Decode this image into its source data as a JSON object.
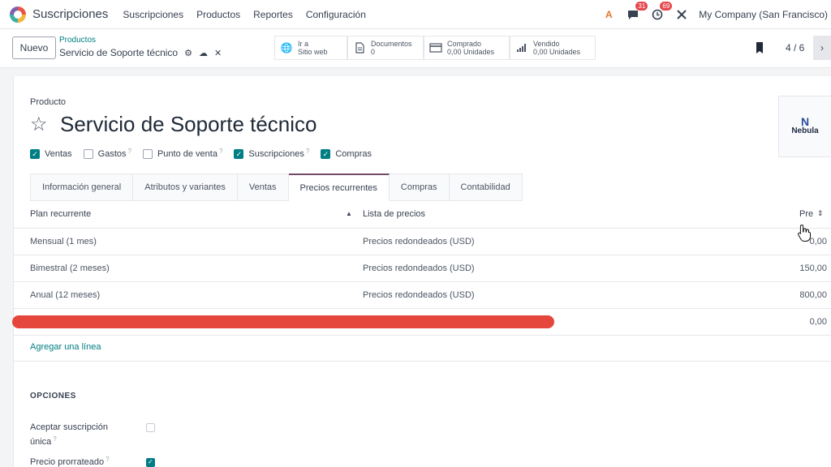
{
  "nav": {
    "app_title": "Suscripciones",
    "menu": [
      "Suscripciones",
      "Productos",
      "Reportes",
      "Configuración"
    ],
    "messages_badge": "31",
    "activities_badge": "69",
    "company": "My Company (San Francisco)"
  },
  "control": {
    "new_label": "Nuevo",
    "breadcrumb_parent": "Productos",
    "breadcrumb_current": "Servicio de Soporte técnico",
    "smart_buttons": [
      {
        "line1": "Ir a",
        "line2": "Sitio web"
      },
      {
        "line1": "Documentos",
        "line2": "0"
      },
      {
        "line1": "Comprado",
        "line2": "0,00 Unidades"
      },
      {
        "line1": "Vendido",
        "line2": "0,00 Unidades"
      }
    ],
    "pager": "4 / 6"
  },
  "form": {
    "label": "Producto",
    "title": "Servicio de Soporte técnico",
    "image_text": "Nebula",
    "checkboxes": [
      {
        "label": "Ventas",
        "checked": true,
        "tip": ""
      },
      {
        "label": "Gastos",
        "checked": false,
        "tip": "?"
      },
      {
        "label": "Punto de venta",
        "checked": false,
        "tip": "?"
      },
      {
        "label": "Suscripciones",
        "checked": true,
        "tip": "?"
      },
      {
        "label": "Compras",
        "checked": true,
        "tip": ""
      }
    ],
    "tabs": [
      "Información general",
      "Atributos y variantes",
      "Ventas",
      "Precios recurrentes",
      "Compras",
      "Contabilidad"
    ],
    "active_tab": "Precios recurrentes"
  },
  "table": {
    "headers": {
      "plan": "Plan recurrente",
      "pricelist": "Lista de precios",
      "price": "Pre"
    },
    "rows": [
      {
        "plan": "Mensual (1 mes)",
        "pricelist": "Precios redondeados (USD)",
        "price": "0,00"
      },
      {
        "plan": "Bimestral (2 meses)",
        "pricelist": "Precios redondeados (USD)",
        "price": "150,00"
      },
      {
        "plan": "Anual (12 meses)",
        "pricelist": "Precios redondeados (USD)",
        "price": "800,00"
      }
    ],
    "redacted_row_price": "0,00",
    "add_line": "Agregar una línea"
  },
  "options": {
    "title": "OPCIONES",
    "single_sub_line1": "Aceptar suscripción",
    "single_sub_line2": "única",
    "single_sub_tip": "?",
    "prorated": "Precio prorrateado",
    "prorated_tip": "?"
  },
  "colors": {
    "accent": "#017e84",
    "tab_active": "#714b67",
    "redaction": "#e5473d"
  }
}
